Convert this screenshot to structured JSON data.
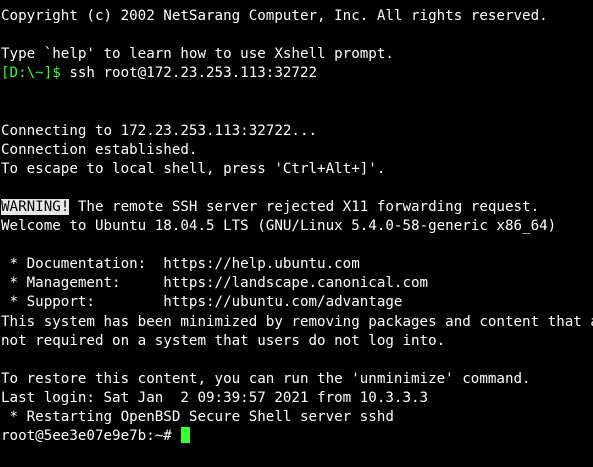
{
  "terminal": {
    "copyright": "Copyright (c) 2002 NetSarang Computer, Inc. All rights reserved.",
    "help_hint": "Type `help' to learn how to use Xshell prompt.",
    "local_prompt": "[D:\\~]$",
    "local_command": " ssh root@172.23.253.113:32722",
    "connecting": "Connecting to 172.23.253.113:32722...",
    "established": "Connection established.",
    "escape_hint": "To escape to local shell, press 'Ctrl+Alt+]'.",
    "warning_label": "WARNING!",
    "warning_text": " The remote SSH server rejected X11 forwarding request.",
    "welcome": "Welcome to Ubuntu 18.04.5 LTS (GNU/Linux 5.4.0-58-generic x86_64)",
    "documentation": " * Documentation:  https://help.ubuntu.com",
    "management": " * Management:     https://landscape.canonical.com",
    "support": " * Support:        https://ubuntu.com/advantage",
    "minimized_1": "This system has been minimized by removing packages and content that are",
    "minimized_2": "not required on a system that users do not log into.",
    "restore_hint": "To restore this content, you can run the 'unminimize' command.",
    "last_login": "Last login: Sat Jan  2 09:39:57 2021 from 10.3.3.3",
    "restarting": " * Restarting OpenBSD Secure Shell server sshd",
    "remote_prompt": "root@5ee3e07e9e7b:~# "
  },
  "colors": {
    "background": "#000000",
    "foreground": "#ffffff",
    "prompt": "#33ff33",
    "cursor": "#33ff33",
    "warning_bg": "#e8e8e8"
  }
}
